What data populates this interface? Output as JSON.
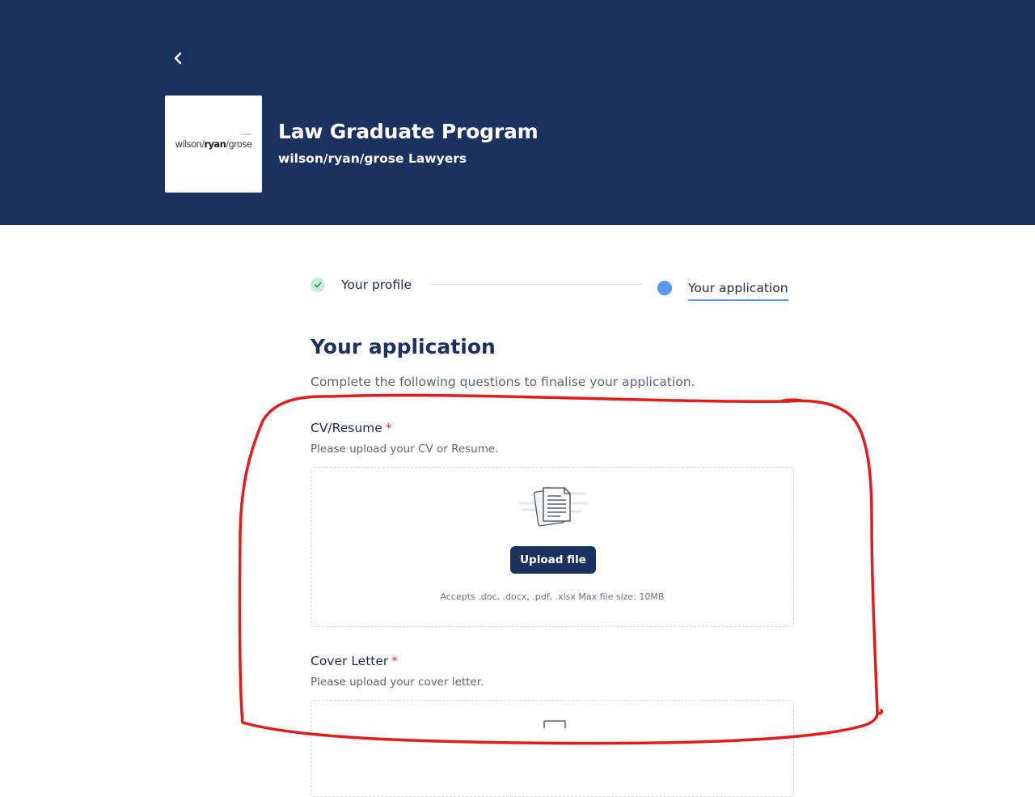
{
  "header": {
    "back_icon": "chevron-left-icon",
    "logo": {
      "left": "wilson",
      "middle": "ryan",
      "right": "grose",
      "tagline": "LAWYERS"
    },
    "program_title": "Law Graduate Program",
    "company_name": "wilson/ryan/grose Lawyers",
    "background_color": "#1b3160"
  },
  "steps": [
    {
      "label": "Your profile",
      "status": "completed",
      "icon": "check-icon"
    },
    {
      "label": "Your application",
      "status": "active"
    }
  ],
  "main": {
    "title": "Your application",
    "subtitle": "Complete the following questions to finalise your application."
  },
  "fields": {
    "cv": {
      "label": "CV/Resume",
      "required_mark": "*",
      "help": "Please upload your CV or Resume.",
      "upload_label": "Upload file",
      "accepts": "Accepts .doc, .docx, .pdf, .xlsx Max file size: 10MB",
      "icon": "document-icon"
    },
    "cover_letter": {
      "label": "Cover Letter",
      "required_mark": "*",
      "help": "Please upload your cover letter.",
      "icon": "document-icon"
    }
  },
  "colors": {
    "accent": "#5b96f2",
    "primary": "#1b3160",
    "required": "#e23b3b",
    "success_bg": "#c8ecd8",
    "annotation": "#e21b1b"
  }
}
